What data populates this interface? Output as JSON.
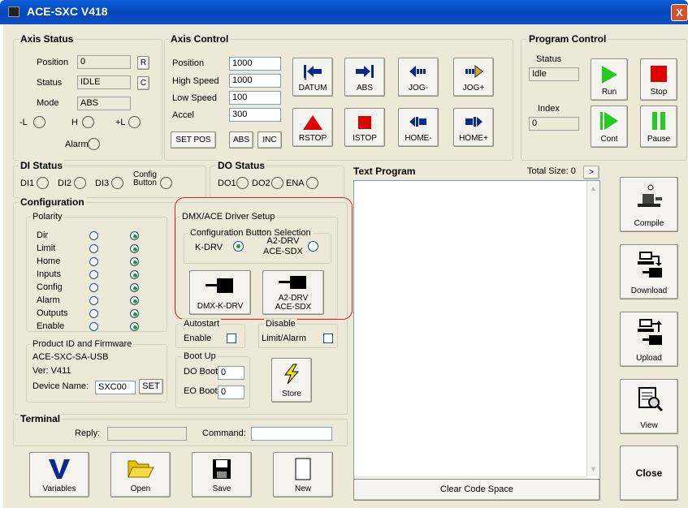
{
  "window": {
    "title": "ACE-SXC V418",
    "close_glyph": "X"
  },
  "axis_status": {
    "title": "Axis Status",
    "position_label": "Position",
    "position_value": "0",
    "r_btn": "R",
    "status_label": "Status",
    "status_value": "IDLE",
    "c_btn": "C",
    "mode_label": "Mode",
    "mode_value": "ABS",
    "neg_limit": "-L",
    "home": "H",
    "pos_limit": "+L",
    "alarm": "Alarm"
  },
  "axis_control": {
    "title": "Axis Control",
    "position_label": "Position",
    "position_value": "1000",
    "high_speed_label": "High Speed",
    "high_speed_value": "1000",
    "low_speed_label": "Low Speed",
    "low_speed_value": "100",
    "accel_label": "Accel",
    "accel_value": "300",
    "set_pos": "SET POS",
    "abs": "ABS",
    "inc": "INC",
    "buttons": {
      "datum": "DATUM",
      "abs": "ABS",
      "jog_minus": "JOG-",
      "jog_plus": "JOG+",
      "rstop": "RSTOP",
      "istop": "ISTOP",
      "home_minus": "HOME-",
      "home_plus": "HOME+"
    }
  },
  "program_control": {
    "title": "Program Control",
    "status_label": "Status",
    "status_value": "Idle",
    "index_label": "Index",
    "index_value": "0",
    "run": "Run",
    "stop": "Stop",
    "cont": "Cont",
    "pause": "Pause"
  },
  "di_status": {
    "title": "DI Status",
    "di1": "DI1",
    "di2": "DI2",
    "di3": "DI3",
    "config_button": "Config\nButton"
  },
  "do_status": {
    "title": "DO Status",
    "do1": "DO1",
    "do2": "DO2",
    "ena": "ENA"
  },
  "configuration": {
    "title": "Configuration",
    "polarity_title": "Polarity",
    "polarity_rows": [
      "Dir",
      "Limit",
      "Home",
      "Inputs",
      "Config",
      "Alarm",
      "Outputs",
      "Enable"
    ]
  },
  "driver_setup": {
    "title": "DMX/ACE Driver Setup",
    "selection_title": "Configuration Button Selection",
    "kdrv": "K-DRV",
    "a2drv_line1": "A2-DRV",
    "a2drv_line2": "ACE-SDX",
    "dmx_btn": "DMX-K-DRV",
    "a2_btn_line1": "A2-DRV",
    "a2_btn_line2": "ACE-SDX"
  },
  "product": {
    "title": "Product ID and Firmware",
    "id": "ACE-SXC-SA-USB",
    "ver": "Ver: V411",
    "device_label": "Device Name:",
    "device_value": "SXC00",
    "set": "SET"
  },
  "autostart": {
    "title": "Autostart",
    "enable": "Enable"
  },
  "disable": {
    "title": "Disable",
    "limit_alarm": "Limit/Alarm"
  },
  "boot_up": {
    "title": "Boot Up",
    "do_boot": "DO Boot",
    "do_boot_value": "0",
    "eo_boot": "EO Boot",
    "eo_boot_value": "0"
  },
  "store": "Store",
  "text_program": {
    "title": "Text Program",
    "total_size": "Total Size: 0",
    "arrow": ">"
  },
  "side_buttons": {
    "compile": "Compile",
    "download": "Download",
    "upload": "Upload",
    "view": "View",
    "close": "Close"
  },
  "terminal": {
    "title": "Terminal",
    "reply_label": "Reply:",
    "command_label": "Command:"
  },
  "bottom_buttons": {
    "variables": "Variables",
    "open": "Open",
    "save": "Save",
    "new": "New",
    "clear": "Clear Code Space"
  },
  "colors": {
    "accent_red": "#e02020",
    "title_blue": "#0546b8",
    "play_green": "#22cc22",
    "stop_red": "#e00000"
  }
}
